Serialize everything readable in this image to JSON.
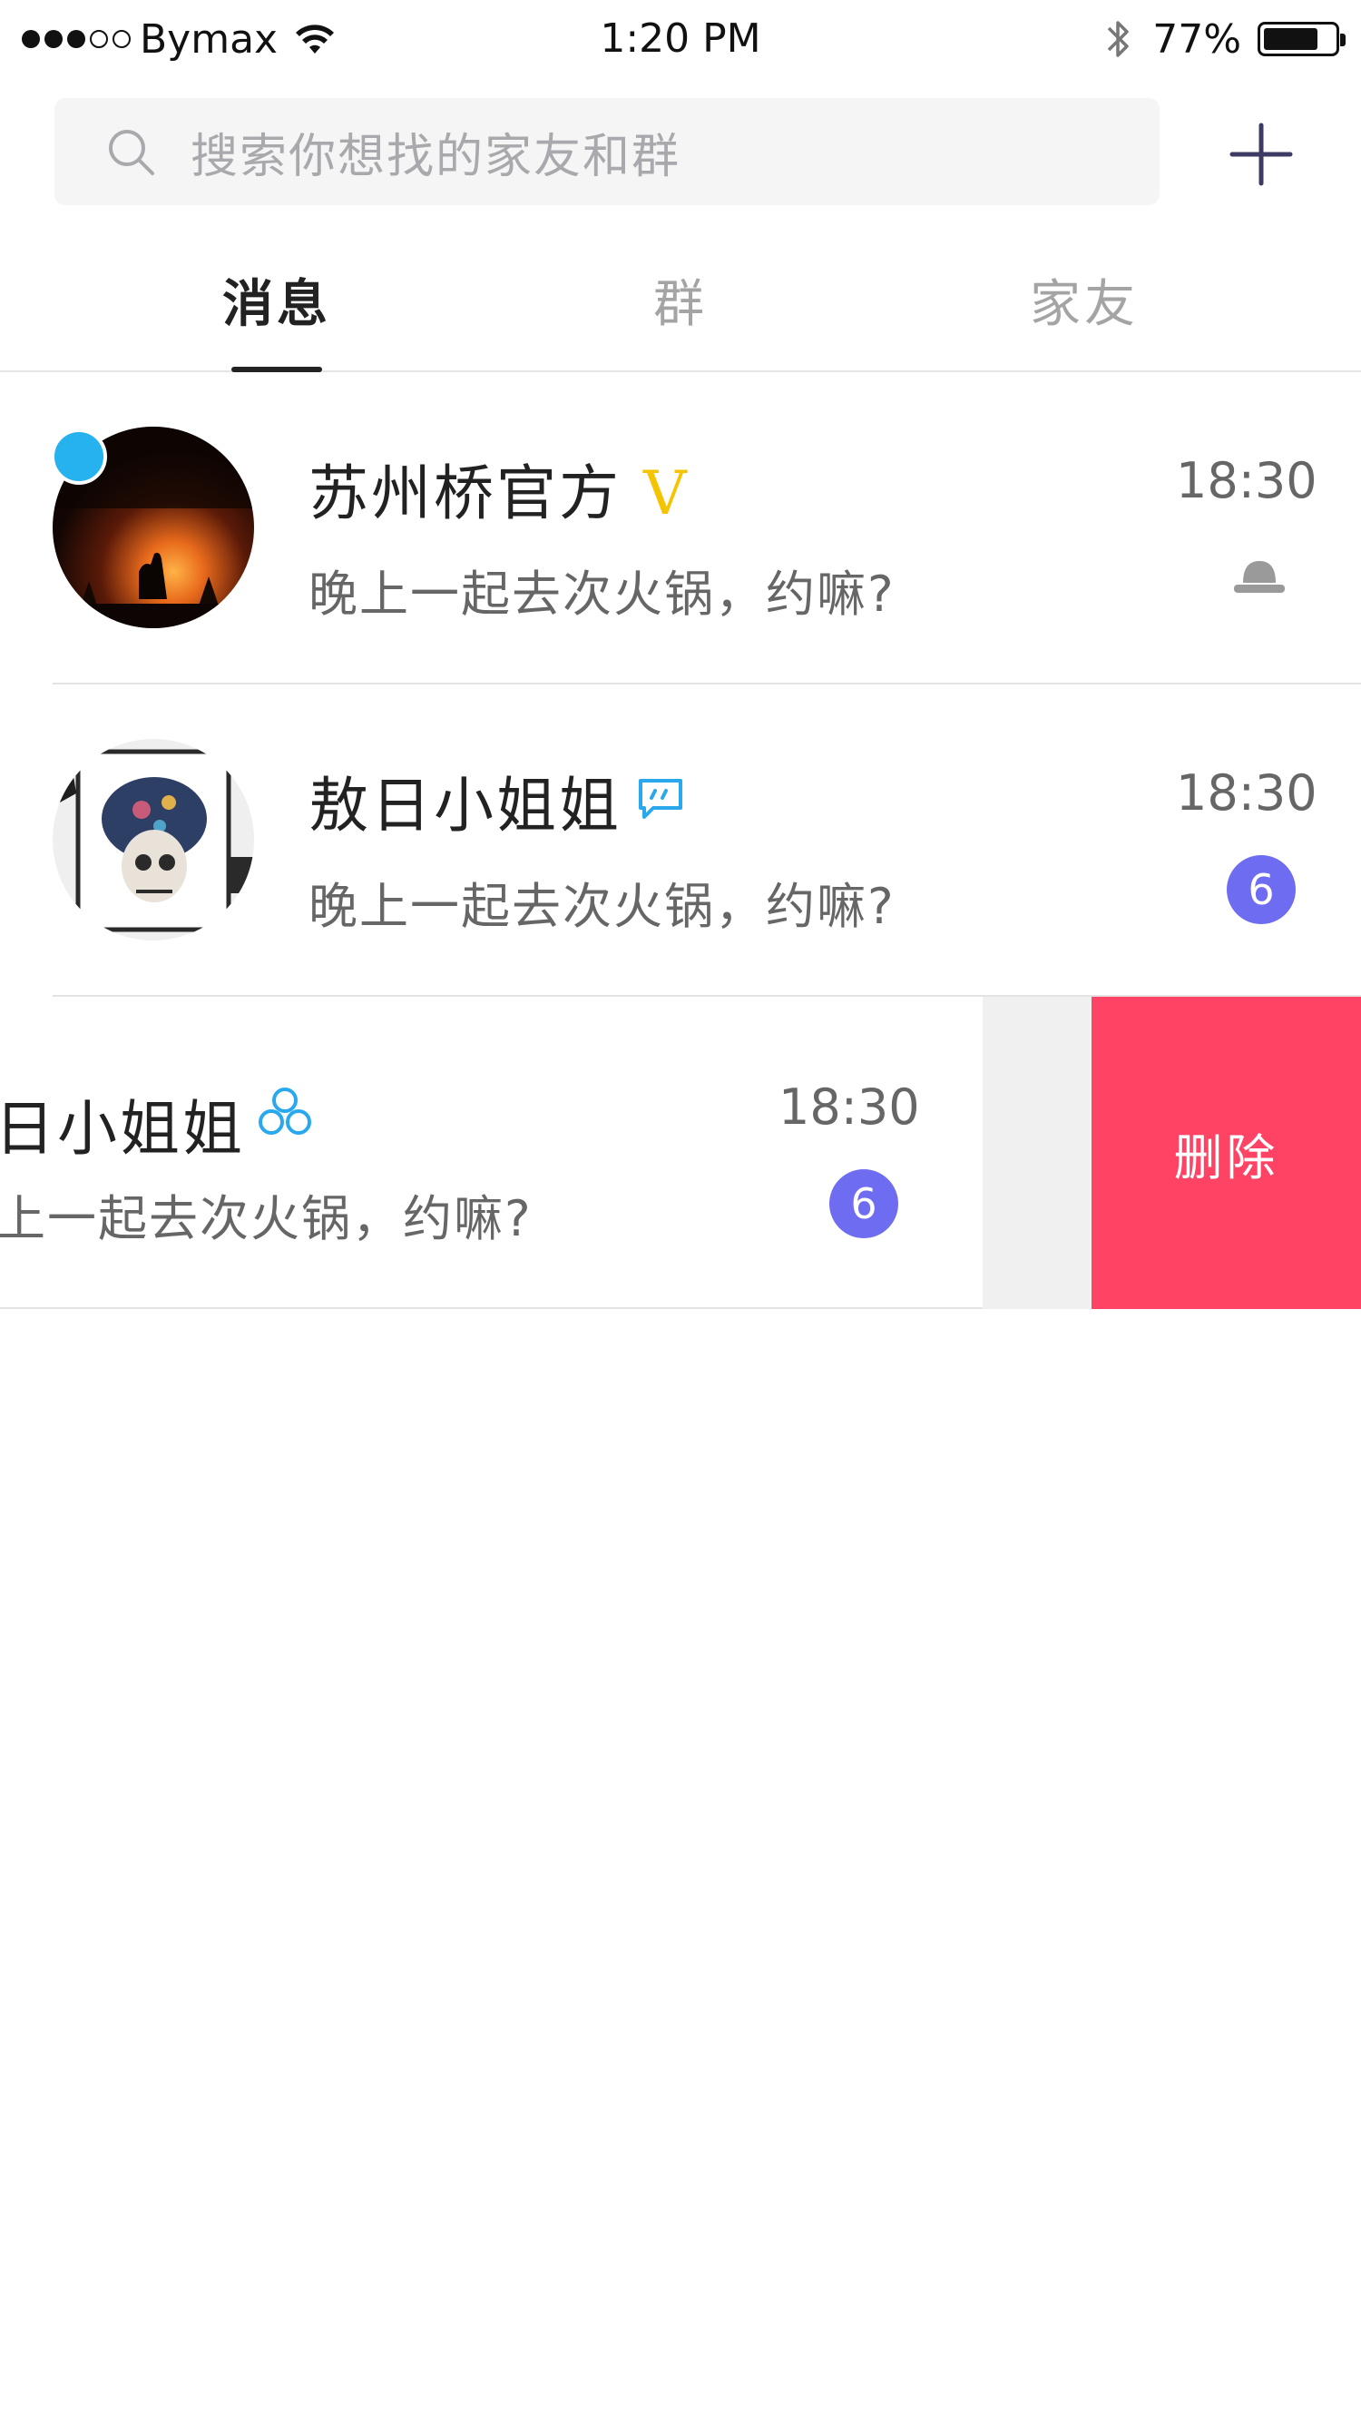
{
  "status_bar": {
    "carrier": "Bymax",
    "time": "1:20 PM",
    "battery": "77%",
    "battery_level": 0.77
  },
  "search": {
    "placeholder": "搜索你想找的家友和群"
  },
  "tabs": [
    {
      "label": "消息",
      "active": true
    },
    {
      "label": "群",
      "active": false
    },
    {
      "label": "家友",
      "active": false
    }
  ],
  "conversations": [
    {
      "name": "苏州桥官方",
      "badge_mark": "V",
      "preview": "晚上一起去次火锅，约嘛?",
      "time": "18:30",
      "icon": "muted-hat-icon",
      "unread_dot": true
    },
    {
      "name": "敖日小姐姐",
      "preview": "晚上一起去次火锅，约嘛?",
      "time": "18:30",
      "icon": "chat-bubble-icon",
      "unread_count": "6"
    },
    {
      "name": "日小姐姐",
      "preview": "上一起去次火锅，约嘛?",
      "time": "18:30",
      "icon": "group-icon",
      "unread_count": "6",
      "action": "删除"
    }
  ],
  "colors": {
    "accent_purple": "#6e6cf0",
    "unread_dot": "#26b1ef",
    "delete_red": "#fe4364",
    "verified_yellow": "#f5c400",
    "icon_blue": "#2aa8ee"
  }
}
